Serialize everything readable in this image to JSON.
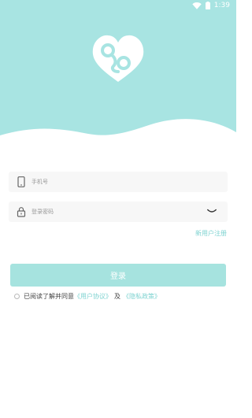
{
  "status_bar": {
    "time": "1:39"
  },
  "login": {
    "phone_placeholder": "手机号",
    "password_placeholder": "登录密码",
    "register_label": "新用户注册",
    "submit_label": "登录"
  },
  "agreement": {
    "prefix": "已阅读了解并同意",
    "user_agreement": "《用户协议》",
    "conjunction": "及",
    "privacy_policy": "《隐私政策》"
  },
  "icons": [
    "wifi-icon",
    "battery-icon",
    "app-logo",
    "phone-icon",
    "lock-icon",
    "eye-closed-icon"
  ],
  "colors": {
    "brand": "#a8e4e2",
    "link": "#7fd3d1",
    "button": "#a6e3df"
  }
}
